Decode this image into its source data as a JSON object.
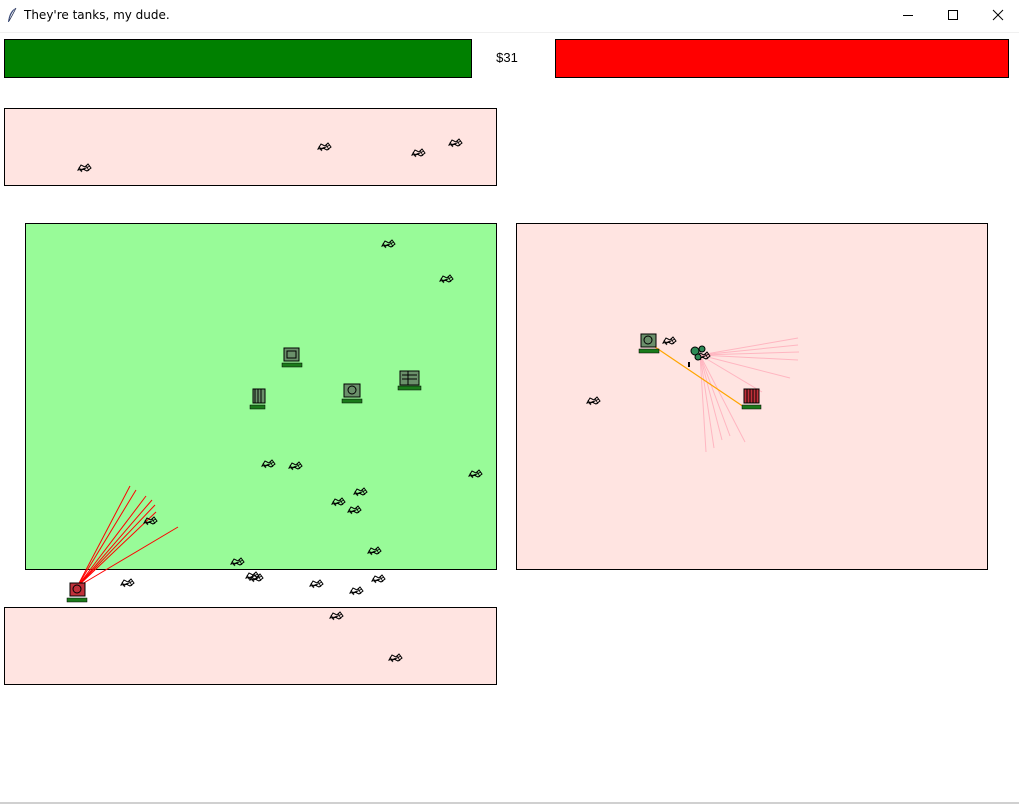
{
  "window": {
    "title": "They're tanks, my dude."
  },
  "hud": {
    "money": "$31",
    "player_health": 1.0,
    "enemy_health": 1.0,
    "player_color": "#008000",
    "enemy_color": "#ff0000"
  },
  "colors": {
    "player_zone": "#98fb98",
    "enemy_zone": "#ffe4e1",
    "player_laser": "#ff0000",
    "enemy_laser": "#ffb6c1",
    "tracer": "#ffa500"
  },
  "icons": {
    "app": "feather-icon",
    "minimize": "minimize-icon",
    "maximize": "maximize-icon",
    "close": "close-icon"
  }
}
